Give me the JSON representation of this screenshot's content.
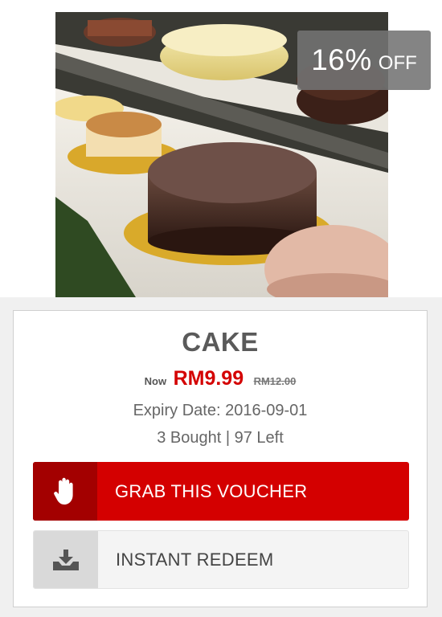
{
  "deal": {
    "discount_percent": "16%",
    "discount_suffix": "OFF",
    "title": "CAKE",
    "price_prefix": "Now",
    "price": "RM9.99",
    "original_price": "RM12.00",
    "expiry_label": "Expiry Date:",
    "expiry_date": "2016-09-01",
    "stats": "3 Bought | 97 Left"
  },
  "actions": {
    "grab_label": "GRAB THIS VOUCHER",
    "grab_icon": "hand-icon",
    "redeem_label": "INSTANT REDEEM",
    "redeem_icon": "download-tray-icon"
  },
  "colors": {
    "accent": "#d40000",
    "accent_dark": "#a30000",
    "badge": "#737373"
  }
}
